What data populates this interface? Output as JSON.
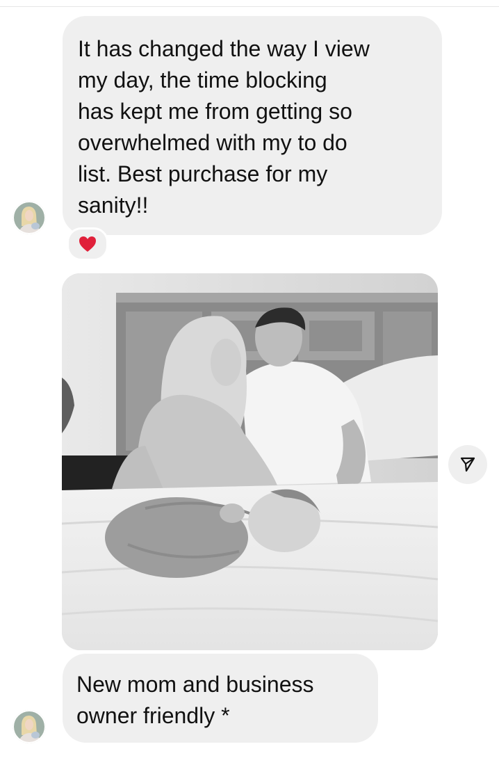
{
  "messages": [
    {
      "type": "text",
      "text": "It has changed the way I view\nmy day, the time blocking\nhas kept me from getting so\noverwhelmed with my to do\nlist. Best purchase for my\nsanity!!",
      "reaction": "heart"
    },
    {
      "type": "image",
      "subject": "family-photo-black-and-white"
    },
    {
      "type": "text",
      "text": "New mom and business\nowner friendly *"
    }
  ],
  "icons": {
    "reaction": "heart-icon",
    "share": "send-icon"
  },
  "colors": {
    "bubble": "#efefef",
    "text": "#111111",
    "heart": "#e0203a",
    "background": "#ffffff"
  }
}
